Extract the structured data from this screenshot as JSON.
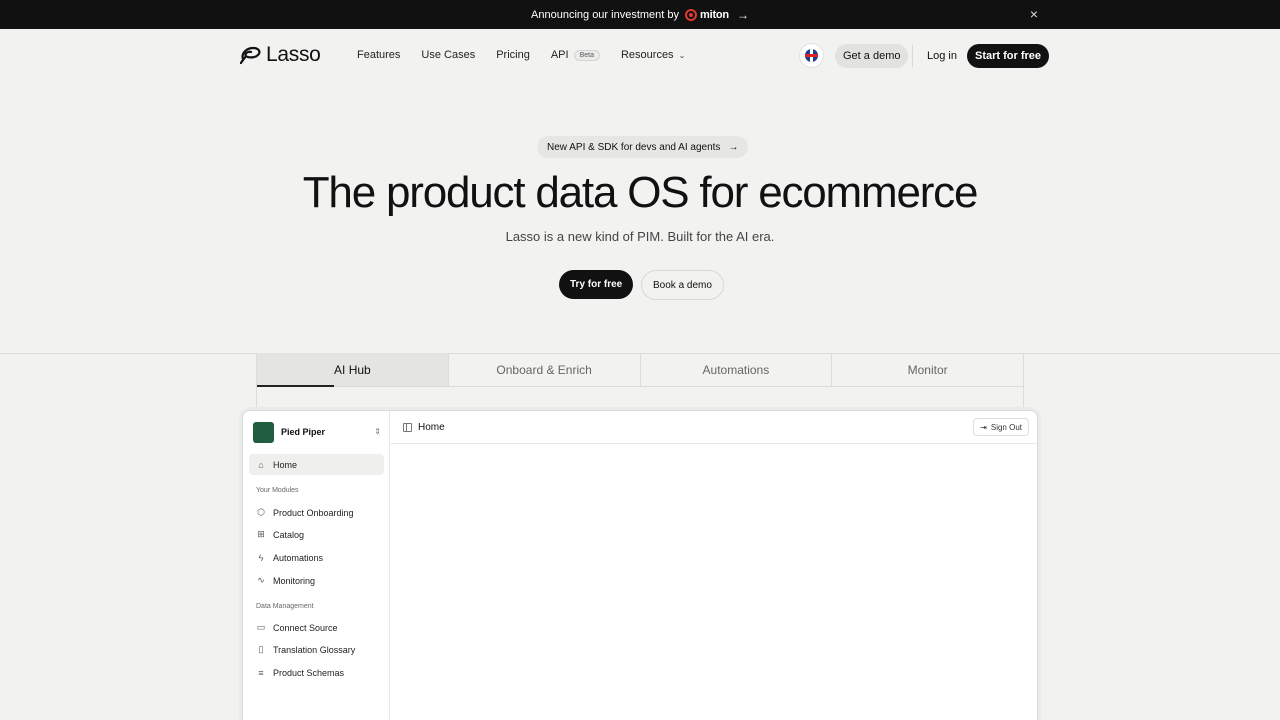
{
  "announcement": {
    "text": "Announcing our investment by",
    "brand": "miton",
    "arrow": "→",
    "close": "×"
  },
  "header": {
    "brand": "Lasso",
    "nav": {
      "features": "Features",
      "use_cases": "Use Cases",
      "pricing": "Pricing",
      "api": "API",
      "api_badge": "Beta",
      "resources": "Resources",
      "resources_chevron": "⌄"
    },
    "get_demo": "Get a demo",
    "login": "Log in",
    "start": "Start for free"
  },
  "hero": {
    "pill": "New API & SDK for devs and AI agents",
    "pill_arrow": "→",
    "title": "The product data OS for ecommerce",
    "subtitle": "Lasso is a new kind of PIM. Built for the AI era.",
    "try_free": "Try for free",
    "book_demo": "Book a demo"
  },
  "tabs": [
    "AI Hub",
    "Onboard & Enrich",
    "Automations",
    "Monitor"
  ],
  "app": {
    "workspace": "Pied Piper",
    "home": "Home",
    "modules_heading": "Your Modules",
    "modules": [
      "Product Onboarding",
      "Catalog",
      "Automations",
      "Monitoring"
    ],
    "data_heading": "Data Management",
    "data_items": [
      "Connect Source",
      "Translation Glossary",
      "Product Schemas"
    ],
    "breadcrumb": "Home",
    "sign_out": "Sign Out"
  },
  "colors": {
    "background": "#f2f2f0",
    "dark": "#111111",
    "workspace_logo": "#1f5e3e",
    "miton_red": "#e03a2f"
  }
}
